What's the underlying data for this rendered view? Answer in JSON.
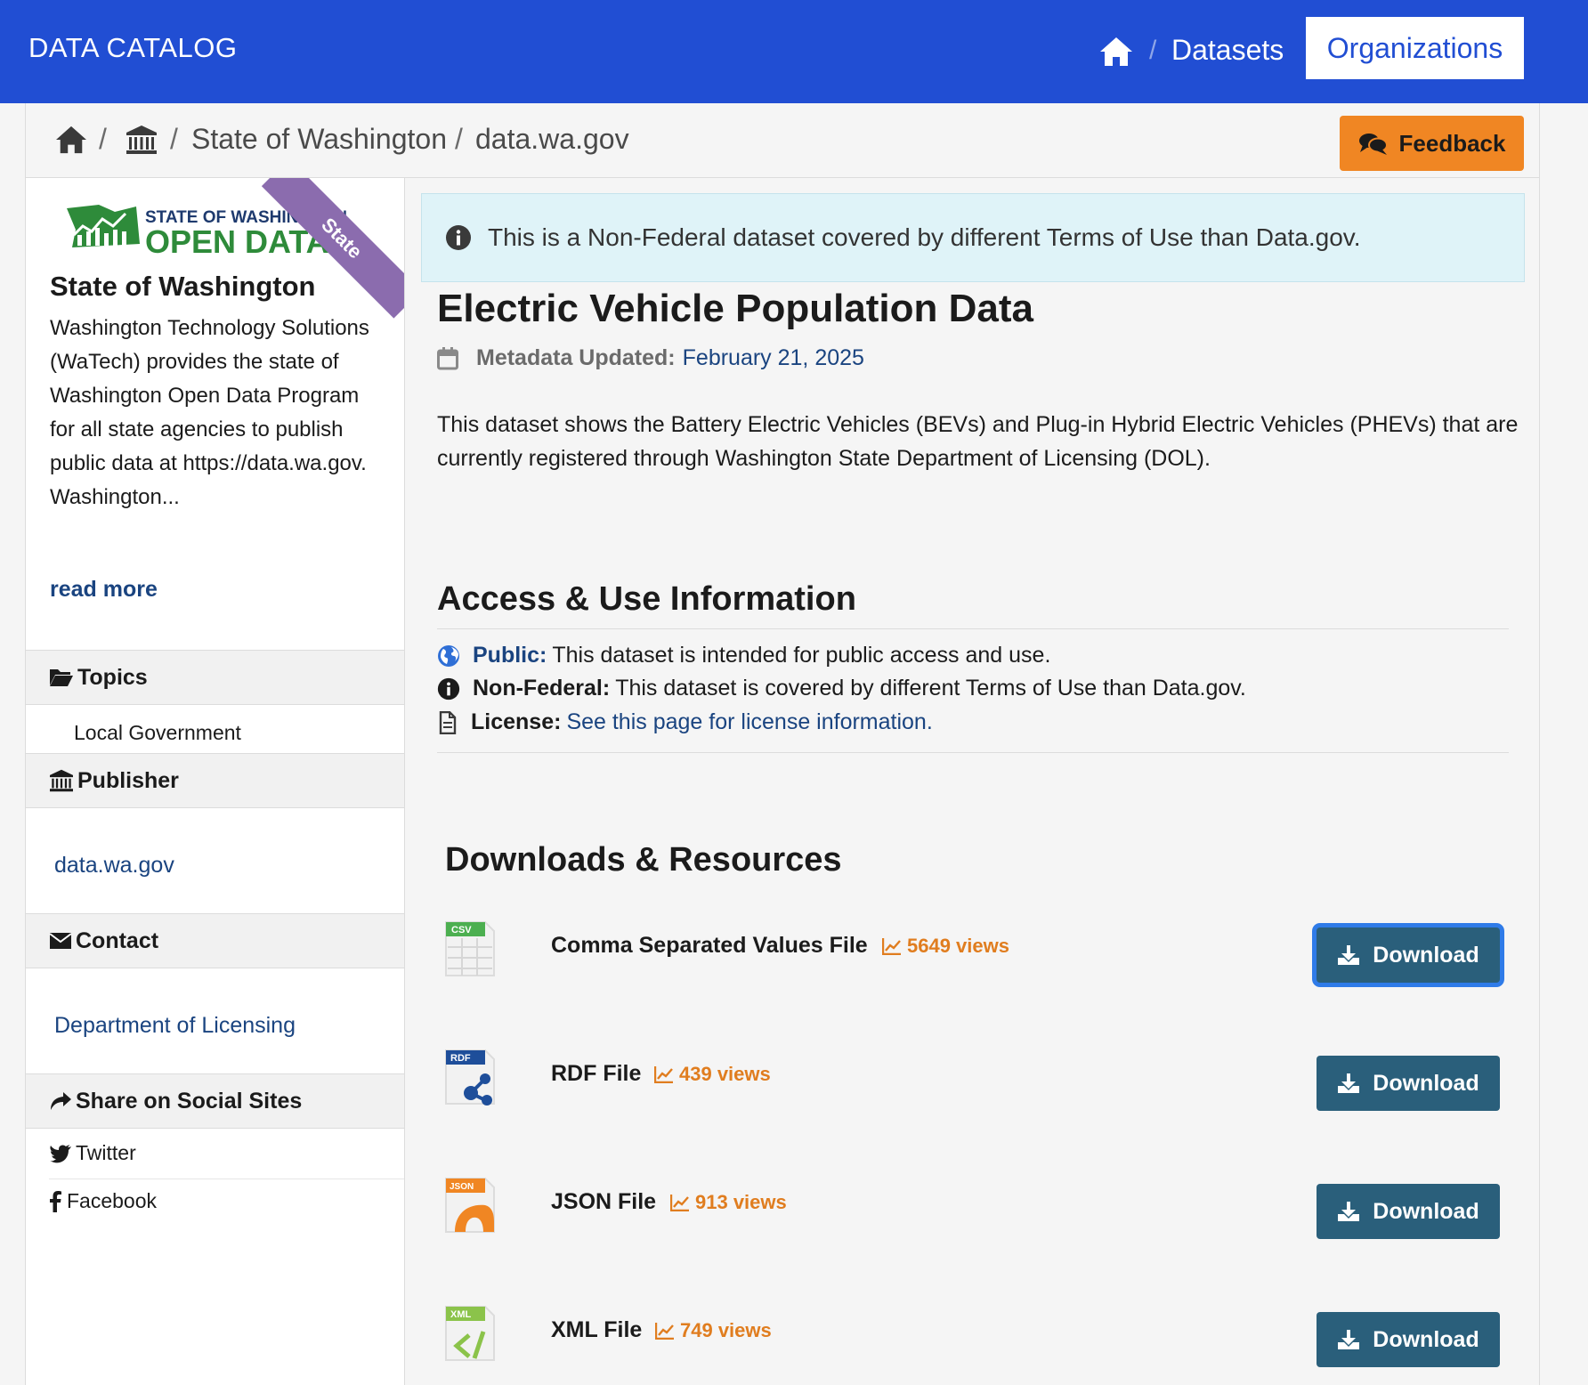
{
  "header": {
    "brand": "DATA CATALOG",
    "nav": {
      "separator": "/",
      "datasets": "Datasets",
      "organizations": "Organizations"
    }
  },
  "breadcrumb": {
    "separator": "/",
    "items": [
      "State of Washington",
      "data.wa.gov"
    ]
  },
  "feedback_label": "Feedback",
  "sidebar": {
    "logo": {
      "line1": "STATE OF WASHINGTON",
      "line2": "OPEN DATA"
    },
    "ribbon": "State",
    "org_name": "State of Washington",
    "org_description": "Washington Technology Solutions (WaTech) provides the state of Washington Open Data Program for all state agencies to publish public data at https://data.wa.gov. Washington...",
    "read_more": "read more",
    "topics": {
      "heading": "Topics",
      "items": [
        "Local Government"
      ]
    },
    "publisher": {
      "heading": "Publisher",
      "value": "data.wa.gov"
    },
    "contact": {
      "heading": "Contact",
      "value": "Department of Licensing"
    },
    "share": {
      "heading": "Share on Social Sites",
      "items": [
        "Twitter",
        "Facebook"
      ]
    }
  },
  "notice": "This is a Non-Federal dataset covered by different Terms of Use than Data.gov.",
  "dataset": {
    "title": "Electric Vehicle Population Data",
    "metadata_label": "Metadata Updated:",
    "metadata_date": "February 21, 2025",
    "description": "This dataset shows the Battery Electric Vehicles (BEVs) and Plug-in Hybrid Electric Vehicles (PHEVs) that are currently registered through Washington State Department of Licensing (DOL)."
  },
  "access": {
    "heading": "Access & Use Information",
    "public_label": "Public:",
    "public_text": "This dataset is intended for public access and use.",
    "nonfederal_label": "Non-Federal:",
    "nonfederal_text": "This dataset is covered by different Terms of Use than Data.gov.",
    "license_label": "License:",
    "license_link": "See this page for license information."
  },
  "downloads": {
    "heading": "Downloads & Resources",
    "button_label": "Download",
    "resources": [
      {
        "badge": "CSV",
        "name": "Comma Separated Values File",
        "views": "5649 views",
        "icon": "csv-file-icon",
        "color": "#4caf50"
      },
      {
        "badge": "RDF",
        "name": "RDF File",
        "views": "439 views",
        "icon": "rdf-file-icon",
        "color": "#1e4e9a"
      },
      {
        "badge": "JSON",
        "name": "JSON File",
        "views": "913 views",
        "icon": "json-file-icon",
        "color": "#f08623"
      },
      {
        "badge": "XML",
        "name": "XML File",
        "views": "749 views",
        "icon": "xml-file-icon",
        "color": "#8bc34a"
      }
    ]
  },
  "colors": {
    "header_blue": "#214ed3",
    "feedback_orange": "#f08623",
    "download_button": "#2a5f7b",
    "link_blue": "#1a4480",
    "views_orange": "#e07d1f",
    "notice_bg": "#dff3f8"
  }
}
